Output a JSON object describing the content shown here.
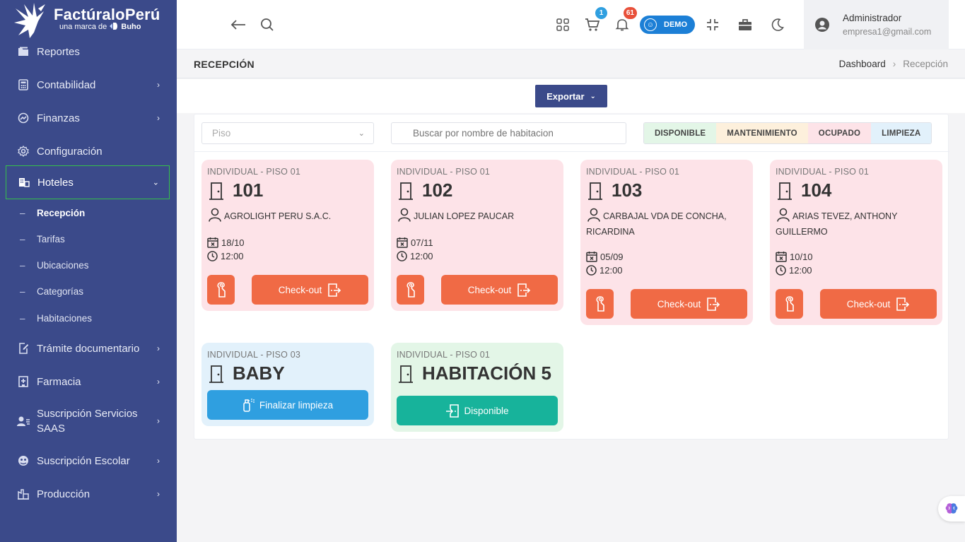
{
  "brand": {
    "name": "FactúraloPerú",
    "tagline_prefix": "una marca de",
    "tagline_brand": "Buho"
  },
  "sidebar": {
    "items": [
      {
        "label": "Reportes",
        "icon": "folder-icon"
      },
      {
        "label": "Contabilidad",
        "icon": "calculator-icon"
      },
      {
        "label": "Finanzas",
        "icon": "chart-circle-icon"
      },
      {
        "label": "Configuración",
        "icon": "gear-icon"
      },
      {
        "label": "Hoteles",
        "icon": "hotel-icon"
      },
      {
        "label": "Trámite documentario",
        "icon": "document-edit-icon"
      },
      {
        "label": "Farmacia",
        "icon": "pharmacy-icon"
      },
      {
        "label": "Suscripción Servicios SAAS",
        "icon": "user-list-icon"
      },
      {
        "label": "Suscripción Escolar",
        "icon": "school-icon"
      },
      {
        "label": "Producción",
        "icon": "factory-icon"
      }
    ],
    "hoteles_sub": [
      "Recepción",
      "Tarifas",
      "Ubicaciones",
      "Categorías",
      "Habitaciones"
    ]
  },
  "topbar": {
    "cart_count": "1",
    "notifications_count": "61",
    "demo_label": "DEMO",
    "user_name": "Administrador",
    "user_email": "empresa1@gmail.com"
  },
  "page": {
    "title": "RECEPCIÓN",
    "breadcrumb": [
      "Dashboard",
      "Recepción"
    ],
    "export_label": "Exportar"
  },
  "filters": {
    "floor_placeholder": "Piso",
    "search_placeholder": "Buscar por nombre de habitacion",
    "legend": [
      {
        "label": "DISPONIBLE",
        "color": "#e3f6e7"
      },
      {
        "label": "MANTENIMIENTO",
        "color": "#fdf0dc"
      },
      {
        "label": "OCUPADO",
        "color": "#fde3e8"
      },
      {
        "label": "LIMPIEZA",
        "color": "#e2f1fb"
      }
    ]
  },
  "rooms": [
    {
      "type": "INDIVIDUAL - PISO 01",
      "name": "101",
      "guest": "AGROLIGHT PERU S.A.C.",
      "date": "18/10",
      "time": "12:00",
      "action": "Check-out"
    },
    {
      "type": "INDIVIDUAL - PISO 01",
      "name": "102",
      "guest": "JULIAN LOPEZ PAUCAR",
      "date": "07/11",
      "time": "12:00",
      "action": "Check-out"
    },
    {
      "type": "INDIVIDUAL - PISO 01",
      "name": "103",
      "guest": "CARBAJAL VDA DE CONCHA, RICARDINA",
      "date": "05/09",
      "time": "12:00",
      "action": "Check-out"
    },
    {
      "type": "INDIVIDUAL - PISO 01",
      "name": "104",
      "guest": "ARIAS TEVEZ, ANTHONY GUILLERMO",
      "date": "10/10",
      "time": "12:00",
      "action": "Check-out"
    },
    {
      "type": "INDIVIDUAL - PISO 03",
      "name": "BABY",
      "action": "Finalizar limpieza"
    },
    {
      "type": "INDIVIDUAL - PISO 01",
      "name": "HABITACIÓN 5",
      "action": "Disponible"
    }
  ],
  "colors": {
    "sidebar": "#3b4a8a",
    "checkout": "#f06a45",
    "cleaning": "#2f9fe0",
    "available": "#17b39b"
  }
}
